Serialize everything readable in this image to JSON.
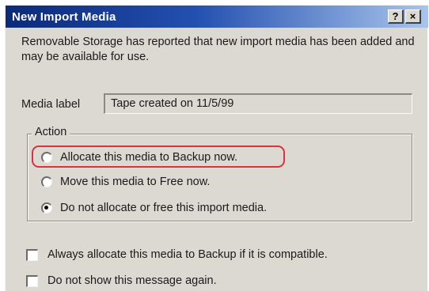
{
  "dialog": {
    "title": "New Import Media",
    "help_glyph": "?",
    "close_glyph": "×",
    "message": "Removable Storage has reported that new import media has been added and may be available for use.",
    "media_label": "Media label",
    "media_value": "Tape created on 11/5/99",
    "action_group_label": "Action",
    "options": [
      {
        "label": "Allocate this media to Backup now.",
        "selected": false
      },
      {
        "label": "Move this media to Free now.",
        "selected": false
      },
      {
        "label": "Do not allocate or free this import media.",
        "selected": true
      }
    ],
    "checkboxes": [
      {
        "label": "Always allocate this media to Backup if it is compatible.",
        "checked": false
      },
      {
        "label": "Do not show this message again.",
        "checked": false
      }
    ]
  },
  "colors": {
    "title_gradient_start": "#0b2a7a",
    "title_gradient_end": "#a9c4ec",
    "dialog_face": "#dcd9d2",
    "highlight_annotation": "#d8343f"
  }
}
